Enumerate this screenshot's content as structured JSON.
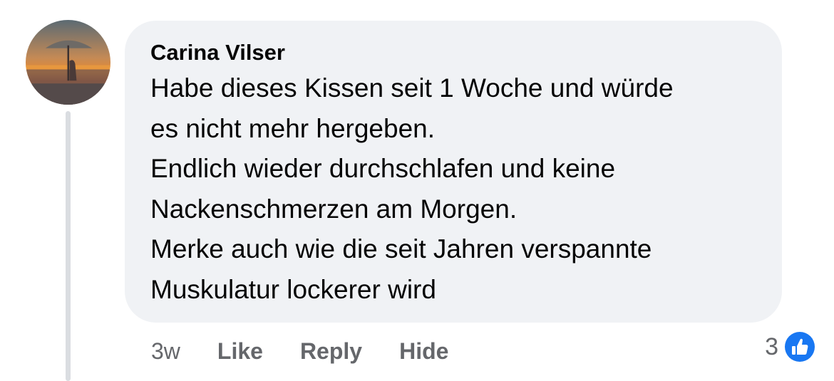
{
  "comment": {
    "author": "Carina Vilser",
    "lines": [
      "Habe dieses Kissen seit 1 Woche und würde",
      "es nicht mehr hergeben.",
      "Endlich wieder durchschlafen und keine",
      "Nackenschmerzen am Morgen.",
      "Merke auch wie die seit Jahren verspannte",
      "Muskulatur lockerer wird"
    ],
    "timestamp": "3w",
    "actions": {
      "like": "Like",
      "reply": "Reply",
      "hide": "Hide"
    },
    "reaction_count": "3",
    "reaction_icon": "thumbs-up-icon"
  },
  "colors": {
    "bubble": "#f0f2f5",
    "text": "#050505",
    "secondary": "#65676b",
    "like_blue": "#1877f2",
    "thread_line": "#dadde1"
  }
}
